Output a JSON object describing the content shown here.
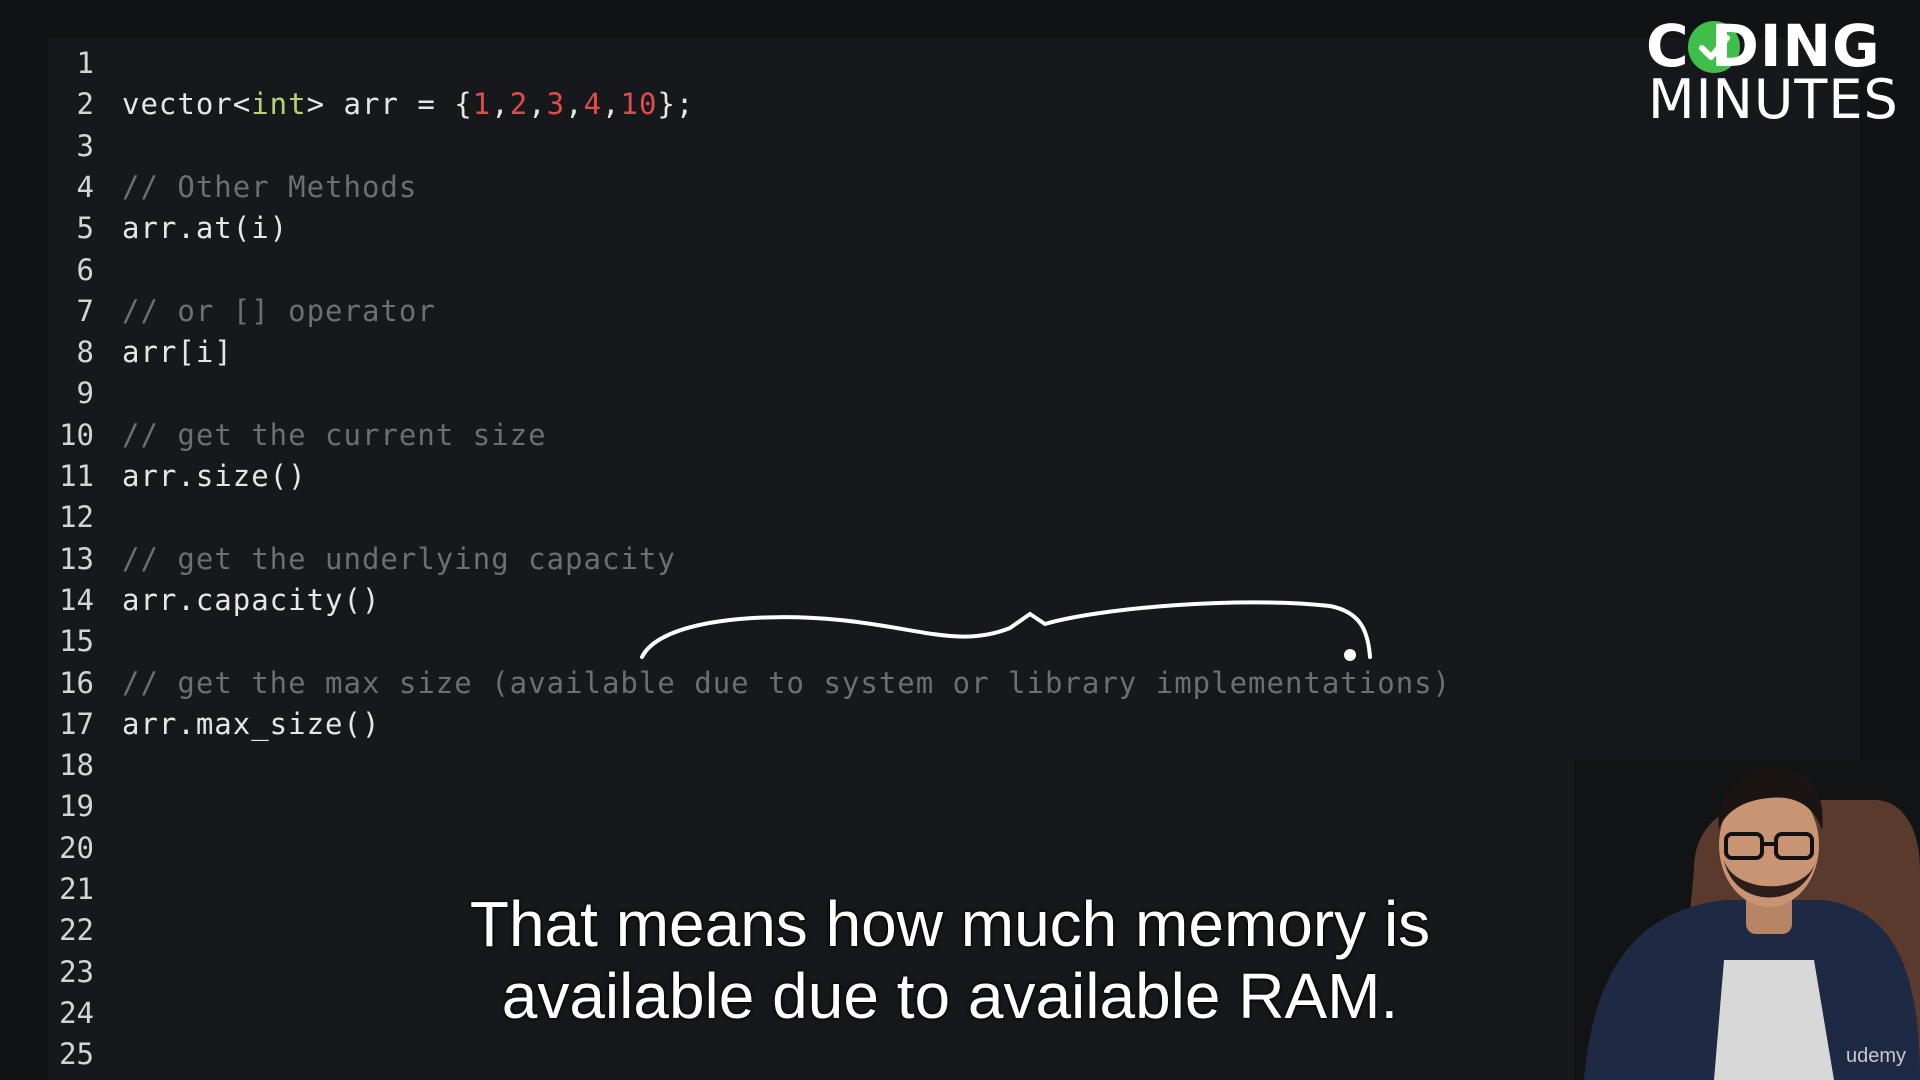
{
  "editor": {
    "lines": [
      {
        "n": "1",
        "tokens": []
      },
      {
        "n": "2",
        "tokens": [
          {
            "t": "vector<",
            "c": "plain"
          },
          {
            "t": "int",
            "c": "type"
          },
          {
            "t": "> arr = {",
            "c": "plain"
          },
          {
            "t": "1",
            "c": "num"
          },
          {
            "t": ",",
            "c": "plain"
          },
          {
            "t": "2",
            "c": "num"
          },
          {
            "t": ",",
            "c": "plain"
          },
          {
            "t": "3",
            "c": "num"
          },
          {
            "t": ",",
            "c": "plain"
          },
          {
            "t": "4",
            "c": "num"
          },
          {
            "t": ",",
            "c": "plain"
          },
          {
            "t": "10",
            "c": "num"
          },
          {
            "t": "};",
            "c": "plain"
          }
        ]
      },
      {
        "n": "3",
        "tokens": []
      },
      {
        "n": "4",
        "tokens": [
          {
            "t": "// Other Methods",
            "c": "comment"
          }
        ]
      },
      {
        "n": "5",
        "tokens": [
          {
            "t": "arr.at(i)",
            "c": "plain"
          }
        ]
      },
      {
        "n": "6",
        "tokens": []
      },
      {
        "n": "7",
        "tokens": [
          {
            "t": "// or [] operator",
            "c": "comment"
          }
        ]
      },
      {
        "n": "8",
        "tokens": [
          {
            "t": "arr[i]",
            "c": "plain"
          }
        ]
      },
      {
        "n": "9",
        "tokens": []
      },
      {
        "n": "10",
        "tokens": [
          {
            "t": "// get the current size",
            "c": "comment"
          }
        ]
      },
      {
        "n": "11",
        "tokens": [
          {
            "t": "arr.size()",
            "c": "plain"
          }
        ]
      },
      {
        "n": "12",
        "tokens": []
      },
      {
        "n": "13",
        "tokens": [
          {
            "t": "// get the underlying capacity",
            "c": "comment"
          }
        ]
      },
      {
        "n": "14",
        "tokens": [
          {
            "t": "arr.capacity()",
            "c": "plain"
          }
        ]
      },
      {
        "n": "15",
        "tokens": []
      },
      {
        "n": "16",
        "tokens": [
          {
            "t": "// get the max size (available due to system or library implementations)",
            "c": "comment"
          }
        ]
      },
      {
        "n": "17",
        "tokens": [
          {
            "t": "arr.max_size()",
            "c": "plain"
          }
        ]
      },
      {
        "n": "18",
        "tokens": []
      },
      {
        "n": "19",
        "tokens": []
      },
      {
        "n": "20",
        "tokens": []
      },
      {
        "n": "21",
        "tokens": []
      },
      {
        "n": "22",
        "tokens": []
      },
      {
        "n": "23",
        "tokens": []
      },
      {
        "n": "24",
        "tokens": []
      },
      {
        "n": "25",
        "tokens": []
      }
    ],
    "colors": {
      "plain": "#e6e6e6",
      "type": "#b7d36f",
      "num": "#e04b4b",
      "comment": "#6b6e72"
    }
  },
  "logo": {
    "top": "C DING",
    "bottom": "MINUTES",
    "check_color": "#3fbf4a"
  },
  "subtitle": {
    "line1": "That means how much memory is",
    "line2": "available due to available RAM."
  },
  "watermark": "udemy"
}
